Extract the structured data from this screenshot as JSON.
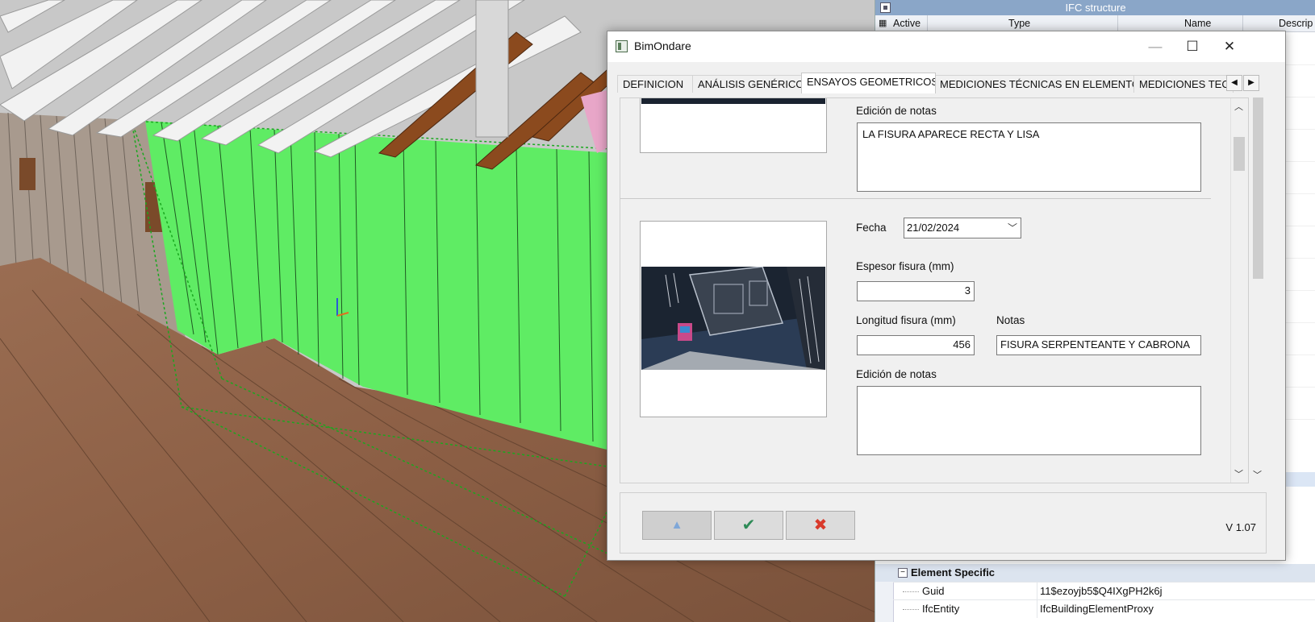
{
  "ifc_panel": {
    "title": "IFC structure",
    "columns": [
      "Active",
      "Type",
      "Name",
      "Descrip"
    ],
    "section": "Element Specific",
    "properties": [
      {
        "key": "Guid",
        "value": "11$ezoyjb5$Q4IXgPH2k6j"
      },
      {
        "key": "IfcEntity",
        "value": "IfcBuildingElementProxy"
      }
    ]
  },
  "dialog": {
    "title": "BimOndare",
    "tabs": [
      {
        "label": "DEFINICION",
        "active": false
      },
      {
        "label": "ANÁLISIS GENÉRICO",
        "active": false
      },
      {
        "label": "ENSAYOS GEOMETRICOS",
        "active": true
      },
      {
        "label": "MEDICIONES TÉCNICAS EN ELEMENTOS",
        "active": false
      },
      {
        "label": "MEDICIONES TECI",
        "active": false
      }
    ],
    "entry1": {
      "notes_label": "Edición de notas",
      "notes_value": "LA FISURA APARECE RECTA Y LISA"
    },
    "entry2": {
      "date_label": "Fecha",
      "date_value": "21/02/2024",
      "thickness_label": "Espesor fisura (mm)",
      "thickness_value": "3",
      "length_label": "Longitud fisura (mm)",
      "length_value": "456",
      "notas_label": "Notas",
      "notas_value": "FISURA SERPENTEANTE Y CABRONA",
      "notes_label": "Edición de notas",
      "notes_value": ""
    },
    "version": "V 1.07"
  }
}
